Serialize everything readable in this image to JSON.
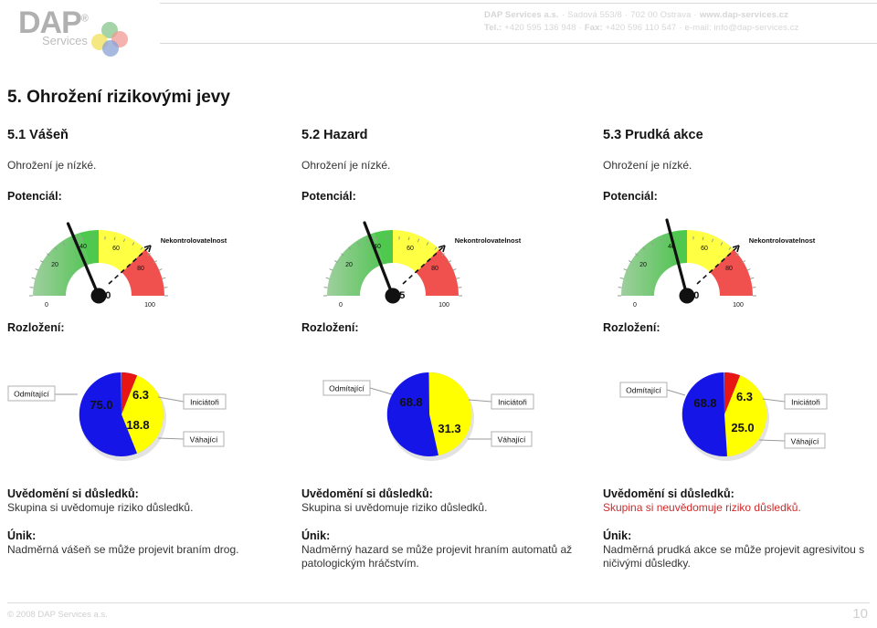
{
  "header": {
    "logo": {
      "name": "DAP",
      "registered": "®",
      "subtitle": "Services"
    },
    "contact": {
      "company": "DAP Services a.s.",
      "address": "Sadová 553/8",
      "city": "702 00 Ostrava",
      "web": "www.dap-services.cz",
      "tel_label": "Tel.:",
      "tel": "+420 595 136 948",
      "fax_label": "Fax:",
      "fax": "+420 596 110 547",
      "email": "e-mail: info@dap-services.cz",
      "separator": "·"
    }
  },
  "section": {
    "title": "5. Ohrožení rizikovými jevy"
  },
  "labels": {
    "potencial": "Potenciál:",
    "rozlozeni": "Rozložení:",
    "awareness_heading": "Uvědomění si důsledků:",
    "escape_heading": "Únik:"
  },
  "columns": [
    {
      "id": "5.1",
      "subtitle": "5.1 Vášeň",
      "risk_text": "Ohrožení je nízké.",
      "gauge_value_text": "42.0",
      "awareness_text": "Skupina si uvědomuje riziko důsledků.",
      "awareness_alert": false,
      "escape_text": "Nadměrná vášeň se může projevit braním drog."
    },
    {
      "id": "5.2",
      "subtitle": "5.2 Hazard",
      "risk_text": "Ohrožení je nízké.",
      "gauge_value_text": "43.5",
      "awareness_text": "Skupina si uvědomuje riziko důsledků.",
      "awareness_alert": false,
      "escape_text": "Nadměrný hazard se může projevit hraním automatů až patologickým hráčstvím."
    },
    {
      "id": "5.3",
      "subtitle": "5.3 Prudká akce",
      "risk_text": "Ohrožení je nízké.",
      "gauge_value_text": "47.0",
      "awareness_text": "Skupina si neuvědomuje riziko důsledků.",
      "awareness_alert": true,
      "escape_text": "Nadměrná prudká akce se může projevit agresivitou s ničivými důsledky."
    }
  ],
  "chart_data": [
    {
      "type": "gauge",
      "title": "Nekontrolovatelnost",
      "chart_for": "5.1 Vášeň",
      "value": 42.0,
      "value_label": "42.0",
      "min": 0,
      "max": 100,
      "tick_labels": [
        "0",
        "20",
        "40",
        "60",
        "80",
        "100"
      ],
      "tick_values": [
        0,
        20,
        40,
        60,
        80,
        100
      ],
      "bands": [
        {
          "from": 0,
          "to": 50,
          "color": "#55c455",
          "label": "low"
        },
        {
          "from": 50,
          "to": 75,
          "color": "#ffff44",
          "label": "medium"
        },
        {
          "from": 75,
          "to": 100,
          "color": "#f0514f",
          "label": "high"
        }
      ]
    },
    {
      "type": "pie",
      "chart_for": "5.1 Vášeň",
      "categories": [
        "Odmítající",
        "Iniciátoři",
        "Váhající"
      ],
      "values": [
        75.0,
        6.3,
        18.8
      ],
      "value_labels": [
        "75.0",
        "6.3",
        "18.8"
      ],
      "colors": [
        "#1515e8",
        "#e81515",
        "#ffff00"
      ],
      "legend_position": "callout"
    },
    {
      "type": "gauge",
      "title": "Nekontrolovatelnost",
      "chart_for": "5.2 Hazard",
      "value": 43.5,
      "value_label": "43.5",
      "min": 0,
      "max": 100,
      "tick_labels": [
        "0",
        "20",
        "40",
        "60",
        "80",
        "100"
      ],
      "tick_values": [
        0,
        20,
        40,
        60,
        80,
        100
      ],
      "bands": [
        {
          "from": 0,
          "to": 50,
          "color": "#55c455",
          "label": "low"
        },
        {
          "from": 50,
          "to": 75,
          "color": "#ffff44",
          "label": "medium"
        },
        {
          "from": 75,
          "to": 100,
          "color": "#f0514f",
          "label": "high"
        }
      ]
    },
    {
      "type": "pie",
      "chart_for": "5.2 Hazard",
      "categories": [
        "Odmítající",
        "Iniciátoři",
        "Váhající"
      ],
      "values": [
        68.8,
        0.0,
        31.3
      ],
      "value_labels": [
        "68.8",
        "",
        "31.3"
      ],
      "colors": [
        "#1515e8",
        "#e81515",
        "#ffff00"
      ],
      "legend_position": "callout"
    },
    {
      "type": "gauge",
      "title": "Nekontrolovatelnost",
      "chart_for": "5.3 Prudká akce",
      "value": 47.0,
      "value_label": "47.0",
      "min": 0,
      "max": 100,
      "tick_labels": [
        "0",
        "20",
        "40",
        "60",
        "80",
        "100"
      ],
      "tick_values": [
        0,
        20,
        40,
        60,
        80,
        100
      ],
      "bands": [
        {
          "from": 0,
          "to": 50,
          "color": "#55c455",
          "label": "low"
        },
        {
          "from": 50,
          "to": 75,
          "color": "#ffff44",
          "label": "medium"
        },
        {
          "from": 75,
          "to": 100,
          "color": "#f0514f",
          "label": "high"
        }
      ]
    },
    {
      "type": "pie",
      "chart_for": "5.3 Prudká akce",
      "categories": [
        "Odmítající",
        "Iniciátoři",
        "Váhající"
      ],
      "values": [
        68.8,
        6.3,
        25.0
      ],
      "value_labels": [
        "68.8",
        "6.3",
        "25.0"
      ],
      "colors": [
        "#1515e8",
        "#e81515",
        "#ffff00"
      ],
      "legend_position": "callout"
    }
  ],
  "footer": {
    "copyright": "© 2008 DAP Services a.s.",
    "page_number": "10"
  }
}
